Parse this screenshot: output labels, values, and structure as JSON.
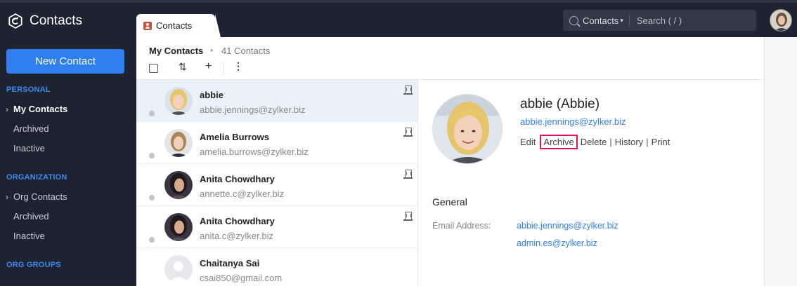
{
  "app": {
    "title": "Contacts",
    "logo_icon": "contacts-logo-icon"
  },
  "sidebar": {
    "new_contact_label": "New Contact",
    "personal_heading": "PERSONAL",
    "personal_items": [
      {
        "label": "My Contacts",
        "active": true
      },
      {
        "label": "Archived"
      },
      {
        "label": "Inactive"
      }
    ],
    "organization_heading": "ORGANIZATION",
    "organization_items": [
      {
        "label": "Org Contacts"
      },
      {
        "label": "Archived"
      },
      {
        "label": "Inactive"
      }
    ],
    "org_groups_heading": "ORG GROUPS",
    "chevron": "›"
  },
  "tab": {
    "label": "Contacts"
  },
  "search": {
    "scope": "Contacts",
    "chevron": "▾",
    "placeholder": "Search ( / )"
  },
  "list_header": {
    "title": "My Contacts",
    "dot": "•",
    "count": "41 Contacts",
    "sort_glyph": "⇅",
    "add_glyph": "+",
    "more_glyph": "⋮"
  },
  "contacts": [
    {
      "name": "abbie",
      "email": "abbie.jennings@zylker.biz",
      "selected": true,
      "org": true
    },
    {
      "name": "Amelia Burrows",
      "email": "amelia.burrows@zylker.biz",
      "org": true
    },
    {
      "name": "Anita Chowdhary",
      "email": "annette.c@zylker.biz",
      "org": true
    },
    {
      "name": "Anita Chowdhary",
      "email": "anita.c@zylker.biz",
      "org": true
    },
    {
      "name": "Chaitanya Sai",
      "email": "csai850@gmail.com",
      "org": false
    }
  ],
  "detail": {
    "name": "abbie (Abbie)",
    "email": "abbie.jennings@zylker.biz",
    "actions": {
      "edit": "Edit",
      "archive": "Archive",
      "delete": "Delete",
      "history": "History",
      "print": "Print",
      "separator": "|"
    },
    "section": "General",
    "email_label": "Email Address:",
    "email_values": [
      "abbie.jennings@zylker.biz",
      "admin.es@zylker.biz"
    ]
  },
  "colors": {
    "accent": "#2f7ff0",
    "highlight": "#e0105a",
    "sidebar_bg": "#1e2331"
  }
}
